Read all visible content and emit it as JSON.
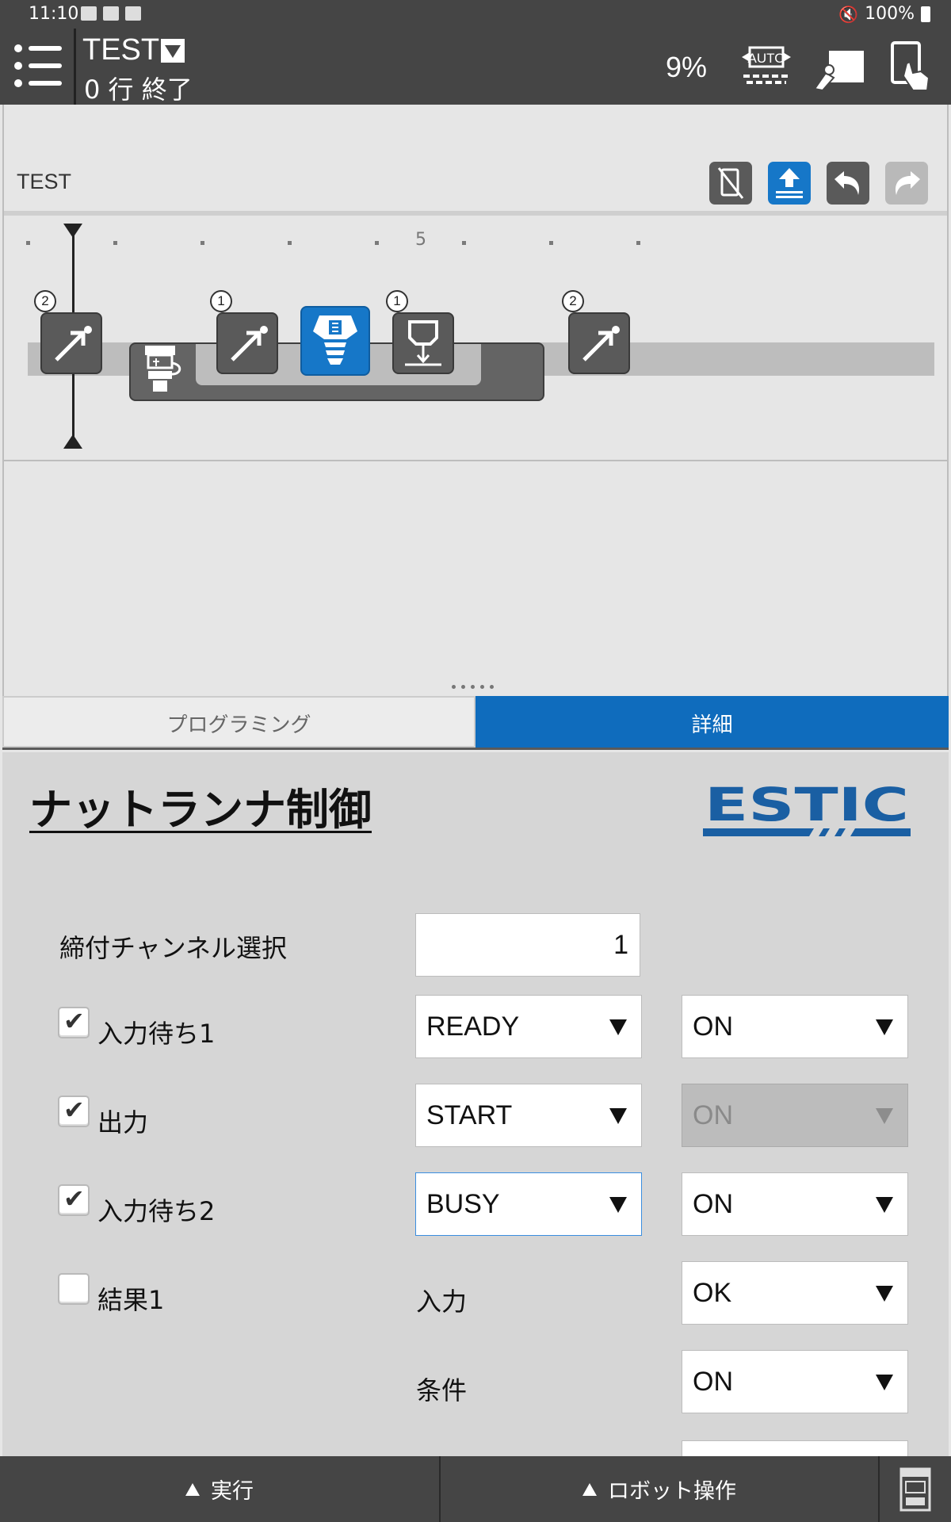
{
  "status_bar": {
    "time": "11:10",
    "battery": "100%"
  },
  "header": {
    "program_name": "TEST",
    "program_status": "0 行 終了",
    "speed": "9%",
    "icons": [
      "menu-icon",
      "auto-mode-icon",
      "robot-teach-icon",
      "touch-panel-icon"
    ]
  },
  "editor": {
    "title": "TEST",
    "toolbar_icons": [
      "hide-teach-icon",
      "upload-icon",
      "undo-icon",
      "redo-icon"
    ],
    "timeline": {
      "marker_label": "5",
      "badges": [
        "2",
        "1",
        "1",
        "2"
      ]
    }
  },
  "tabs": [
    {
      "label": "プログラミング",
      "active": false
    },
    {
      "label": "詳細",
      "active": true
    }
  ],
  "detail": {
    "title": "ナットランナ制御",
    "logo_text": "ESTIC",
    "channel": {
      "label": "締付チャンネル選択",
      "value": "1"
    },
    "wait1": {
      "label": "入力待ち1",
      "checked": true,
      "signal": "READY",
      "state": "ON"
    },
    "output": {
      "label": "出力",
      "checked": true,
      "signal": "START",
      "state": "ON"
    },
    "wait2": {
      "label": "入力待ち2",
      "checked": true,
      "signal": "BUSY",
      "state": "ON"
    },
    "result1": {
      "label": "結果1",
      "checked": false,
      "input_label": "入力",
      "input_value": "OK",
      "condition_label": "条件",
      "condition_value": "ON"
    }
  },
  "bottom_bar": {
    "run_label": "実行",
    "robot_label": "ロボット操作"
  },
  "colors": {
    "header_bg": "#454545",
    "accent_blue": "#0f6cbd",
    "panel_bg": "#d6d6d6"
  }
}
